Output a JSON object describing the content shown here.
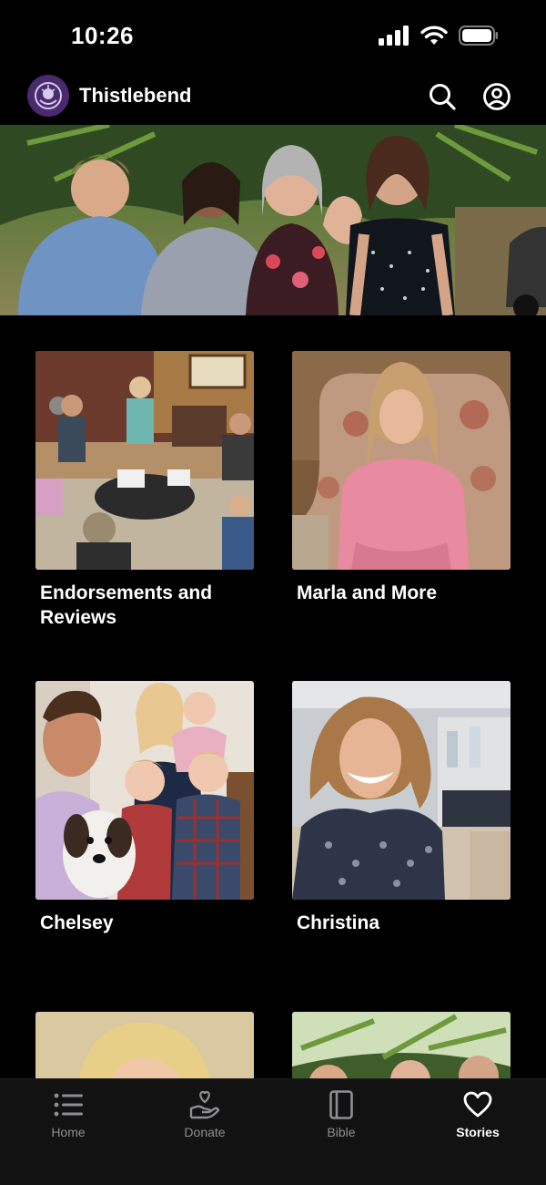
{
  "status_bar": {
    "time": "10:26"
  },
  "header": {
    "app_title": "Thistlebend",
    "logo_icon": "thistlebend-logo-icon",
    "search_icon": "search-icon",
    "account_icon": "account-icon"
  },
  "hero": {
    "image": "group-of-four-women-outdoors"
  },
  "stories": [
    {
      "title": "Endorsements and Reviews",
      "image": "women-group-study-room"
    },
    {
      "title": "Marla and More",
      "image": "woman-pink-dress-interview"
    },
    {
      "title": "Chelsey",
      "image": "family-with-puppy"
    },
    {
      "title": "Christina",
      "image": "woman-smiling-interview"
    },
    {
      "title": "",
      "image": "woman-blonde-portrait"
    },
    {
      "title": "",
      "image": "group-outdoors-palms"
    }
  ],
  "tab_bar": {
    "tabs": [
      {
        "label": "Home",
        "icon": "list-icon",
        "active": false
      },
      {
        "label": "Donate",
        "icon": "donate-hand-heart-icon",
        "active": false
      },
      {
        "label": "Bible",
        "icon": "book-icon",
        "active": false
      },
      {
        "label": "Stories",
        "icon": "heart-icon",
        "active": true
      }
    ]
  },
  "colors": {
    "background": "#000000",
    "tab_bar_background": "#121212",
    "logo_purple": "#4a2a6e",
    "inactive_tab": "#8e8e93",
    "active_tab": "#ffffff"
  }
}
